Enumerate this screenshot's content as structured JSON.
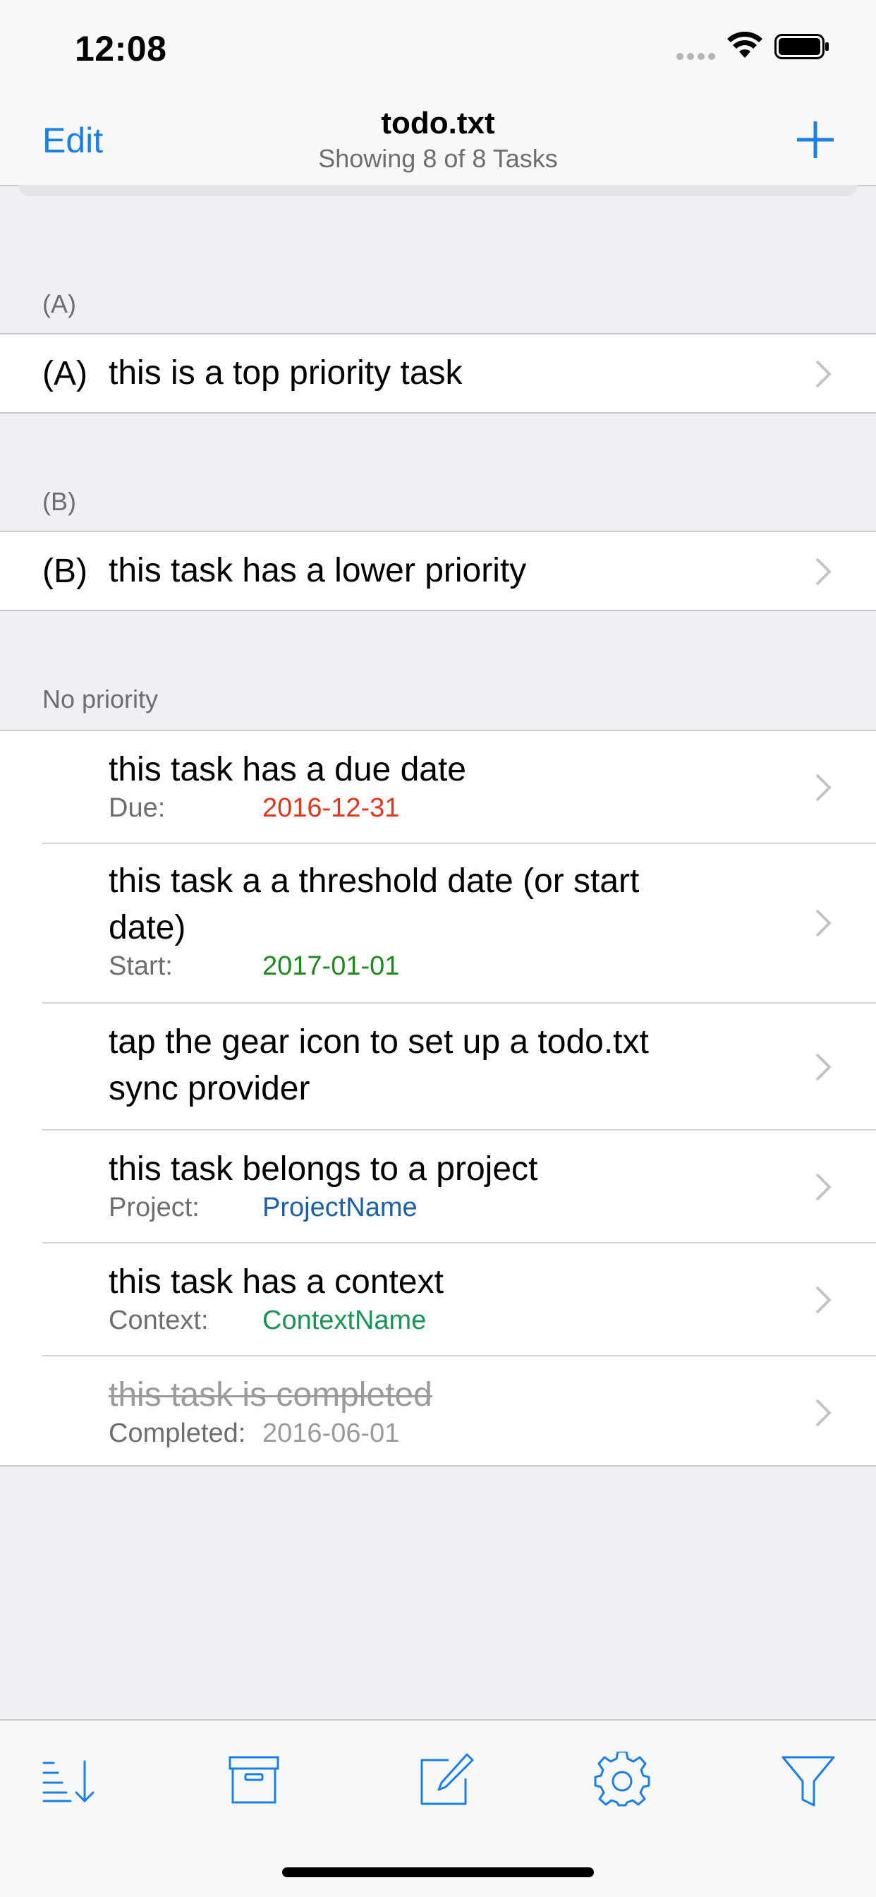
{
  "status_bar": {
    "time": "12:08"
  },
  "nav": {
    "edit_label": "Edit",
    "title": "todo.txt",
    "subtitle": "Showing 8 of 8 Tasks"
  },
  "sections": {
    "a": {
      "header": "(A)",
      "task": {
        "priority": "(A)",
        "text": "this is a top priority task"
      }
    },
    "b": {
      "header": "(B)",
      "task": {
        "priority": "(B)",
        "text": "this task has a lower priority"
      }
    },
    "none": {
      "header": "No priority",
      "tasks": [
        {
          "text": "this task has a due date",
          "meta_label": "Due:",
          "meta_value": "2016-12-31"
        },
        {
          "text": "this task a a threshold date (or start date)",
          "meta_label": "Start:",
          "meta_value": "2017-01-01"
        },
        {
          "text": "tap the gear icon to set up a todo.txt sync provider"
        },
        {
          "text": "this task belongs to a project",
          "meta_label": "Project:",
          "meta_value": "ProjectName"
        },
        {
          "text": "this task has a context",
          "meta_label": "Context:",
          "meta_value": "ContextName"
        },
        {
          "text": "this task is completed",
          "meta_label": "Completed:",
          "meta_value": "2016-06-01"
        }
      ]
    }
  },
  "colors": {
    "accent": "#1a7fe6",
    "due": "#e0361c",
    "start": "#1e8a1e",
    "project": "#1a5fa8",
    "context": "#1a9456",
    "completed": "#9b9b9b"
  },
  "toolbar": {
    "icons": [
      "sort-icon",
      "archive-icon",
      "compose-icon",
      "gear-icon",
      "filter-icon"
    ]
  }
}
